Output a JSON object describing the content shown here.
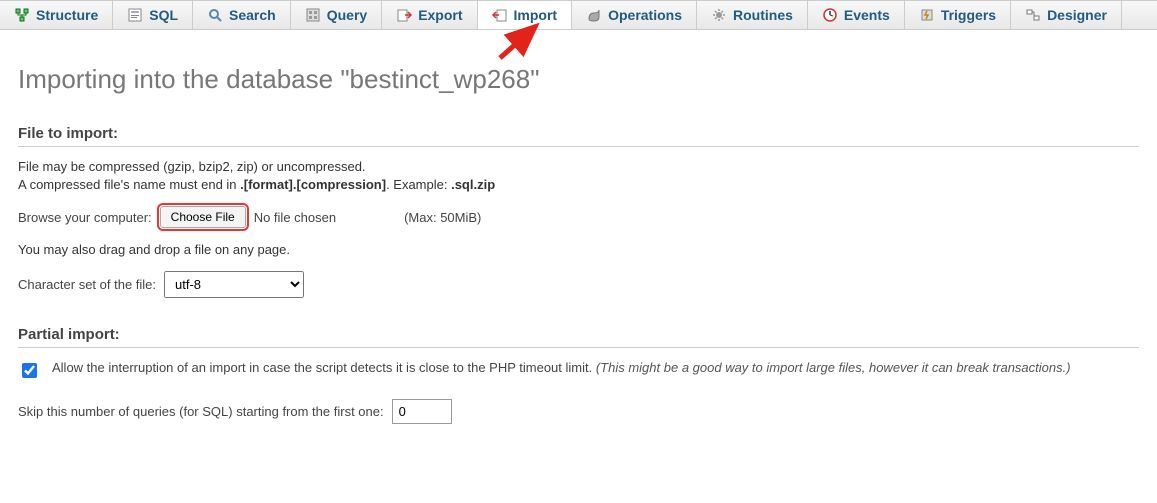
{
  "tabs": [
    {
      "label": "Structure"
    },
    {
      "label": "SQL"
    },
    {
      "label": "Search"
    },
    {
      "label": "Query"
    },
    {
      "label": "Export"
    },
    {
      "label": "Import"
    },
    {
      "label": "Operations"
    },
    {
      "label": "Routines"
    },
    {
      "label": "Events"
    },
    {
      "label": "Triggers"
    },
    {
      "label": "Designer"
    }
  ],
  "page_title": "Importing into the database \"bestinct_wp268\"",
  "file_section": {
    "heading": "File to import:",
    "help1": "File may be compressed (gzip, bzip2, zip) or uncompressed.",
    "help2_prefix": "A compressed file's name must end in ",
    "help2_bold1": ".[format].[compression]",
    "help2_mid": ". Example: ",
    "help2_bold2": ".sql.zip",
    "browse_label": "Browse your computer:",
    "choose_file_btn": "Choose File",
    "no_file": "No file chosen",
    "max_size": "(Max: 50MiB)",
    "drag_hint": "You may also drag and drop a file on any page.",
    "charset_label": "Character set of the file:",
    "charset_value": "utf-8"
  },
  "partial_section": {
    "heading": "Partial import:",
    "allow_text": "Allow the interruption of an import in case the script detects it is close to the PHP timeout limit. ",
    "allow_italic": "(This might be a good way to import large files, however it can break transactions.)",
    "allow_checked": true,
    "skip_label": "Skip this number of queries (for SQL) starting from the first one:",
    "skip_value": "0"
  }
}
